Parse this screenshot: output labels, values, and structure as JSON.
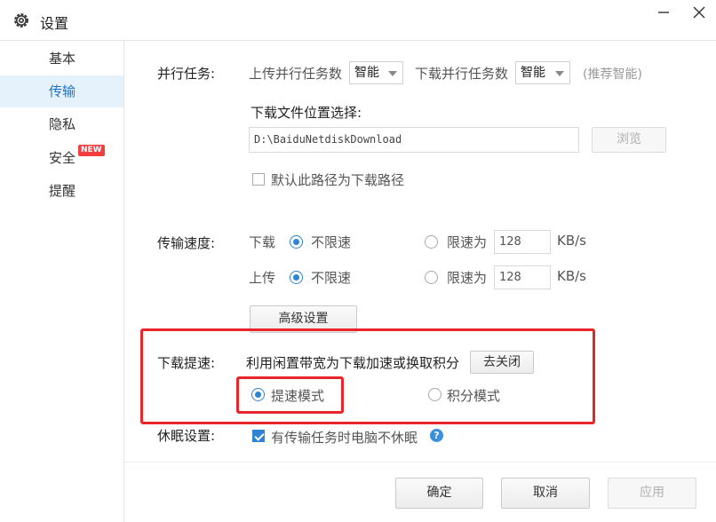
{
  "window": {
    "title": "设置",
    "close_glyph": "×"
  },
  "sidebar": {
    "items": [
      {
        "label": "基本"
      },
      {
        "label": "传输"
      },
      {
        "label": "隐私"
      },
      {
        "label": "安全",
        "badge": "NEW"
      },
      {
        "label": "提醒"
      }
    ],
    "active_index": 1
  },
  "parallel": {
    "label": "并行任务:",
    "upload_label": "上传并行任务数",
    "upload_value": "智能",
    "download_label": "下载并行任务数",
    "download_value": "智能",
    "hint": "(推荐智能)"
  },
  "download_location": {
    "label": "下载文件位置选择:",
    "path": "D:\\BaiduNetdiskDownload",
    "browse_label": "浏览",
    "default_checkbox_label": "默认此路径为下载路径",
    "default_checked": false
  },
  "speed": {
    "label": "传输速度:",
    "download": {
      "label": "下载",
      "unlimited_label": "不限速",
      "limit_label": "限速为",
      "limit_value": "128",
      "unit": "KB/s",
      "unlimited_checked": true
    },
    "upload": {
      "label": "上传",
      "unlimited_label": "不限速",
      "limit_label": "限速为",
      "limit_value": "128",
      "unit": "KB/s",
      "unlimited_checked": true
    },
    "advanced_label": "高级设置"
  },
  "accel": {
    "label": "下载提速:",
    "description": "利用闲置带宽为下载加速或换取积分",
    "toggle_label": "去关闭",
    "mode_speed_label": "提速模式",
    "mode_points_label": "积分模式",
    "speed_checked": true
  },
  "sleep": {
    "label": "休眠设置:",
    "checkbox_label": "有传输任务时电脑不休眠",
    "checked": true,
    "help_glyph": "?"
  },
  "footer": {
    "ok": "确定",
    "cancel": "取消",
    "apply": "应用"
  },
  "colors": {
    "accent": "#2e83d5",
    "highlight": "#e8262a",
    "active_bg": "#e5f1fb"
  }
}
